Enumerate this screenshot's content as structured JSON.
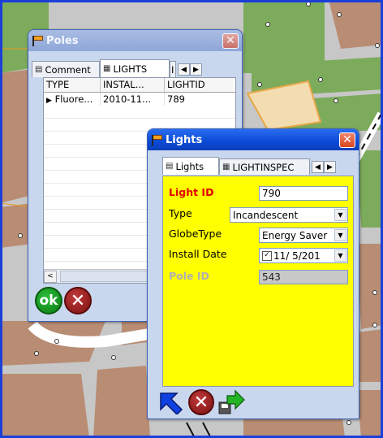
{
  "poles_window": {
    "title": "Poles",
    "close": "✕",
    "tabs": [
      {
        "icon": "▤",
        "label": "Comment"
      },
      {
        "icon": "▦",
        "label": "LIGHTS"
      },
      {
        "icon": "",
        "label": "I"
      }
    ],
    "table": {
      "headers": [
        "TYPE",
        "INSTAL...",
        "LIGHTID"
      ],
      "rows": [
        {
          "marker": "▶",
          "type": "Fluore...",
          "install": "2010-11...",
          "lightid": "789"
        }
      ]
    },
    "scroll_left": "<",
    "ok_label": "ok",
    "cancel_label": "✕"
  },
  "lights_window": {
    "title": "Lights",
    "close": "✕",
    "tabs": [
      {
        "icon": "▤",
        "label": "Lights"
      },
      {
        "icon": "▦",
        "label": "LIGHTINSPEC"
      }
    ],
    "fields": {
      "light_id": {
        "label": "Light ID",
        "value": "790"
      },
      "type": {
        "label": "Type",
        "value": "Incandescent"
      },
      "globe_type": {
        "label": "GlobeType",
        "value": "Energy Saver"
      },
      "install_date": {
        "label": "Install Date",
        "value": "11/ 5/201",
        "checked": "✓"
      },
      "pole_id": {
        "label": "Pole ID",
        "value": "543"
      }
    }
  },
  "colors": {
    "map_green": "#7dab5c",
    "map_brown": "#b88d74",
    "map_gray": "#c8c8c8",
    "form_yellow": "#ffff00",
    "title_blue": "#0b4ad4"
  }
}
